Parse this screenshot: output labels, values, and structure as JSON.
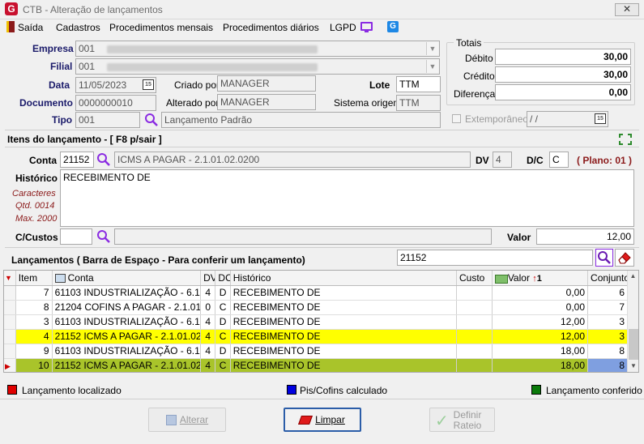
{
  "window": {
    "title": "CTB - Alteração de lançamentos",
    "close_glyph": "✕"
  },
  "menu": [
    "Saída",
    "Cadastros",
    "Procedimentos mensais",
    "Procedimentos diários",
    "LGPD"
  ],
  "form": {
    "empresa_label": "Empresa",
    "empresa_code": "001",
    "filial_label": "Filial",
    "filial_code": "001",
    "data_label": "Data",
    "data_value": "11/05/2023",
    "criado_label": "Criado por",
    "criado_value": "MANAGER",
    "lote_label": "Lote",
    "lote_value": "TTM",
    "documento_label": "Documento",
    "documento_value": "0000000010",
    "alterado_label": "Alterado por",
    "alterado_value": "MANAGER",
    "sistema_label": "Sistema origem",
    "sistema_value": "TTM",
    "tipo_label": "Tipo",
    "tipo_code": "001",
    "tipo_desc": "Lançamento Padrão",
    "extemporaneo_label": "Extemporâneo",
    "extemporaneo_date": " / /",
    "cal_glyph": "15"
  },
  "totais": {
    "title": "Totais",
    "debito_label": "Débito",
    "debito_value": "30,00",
    "credito_label": "Crédito",
    "credito_value": "30,00",
    "diferenca_label": "Diferença",
    "diferenca_value": "0,00"
  },
  "itens": {
    "header": "Itens do lançamento - [ F8 p/sair ]",
    "conta_label": "Conta",
    "conta_code": "21152",
    "conta_desc": "ICMS A PAGAR - 2.1.01.02.0200",
    "dv_label": "DV",
    "dv_value": "4",
    "dc_label": "D/C",
    "dc_value": "C",
    "plano": "( Plano: 01 )",
    "historico_label": "Histórico",
    "historico_value": "RECEBIMENTO DE",
    "caracteres_label": "Caracteres",
    "qtd_label": "Qtd. 0014",
    "max_label": "Max. 2000",
    "ccustos_label": "C/Custos",
    "valor_label": "Valor",
    "valor_value": "12,00"
  },
  "lancamentos": {
    "header": "Lançamentos ( Barra de Espaço - Para conferir um lançamento)",
    "search_value": "21152",
    "columns": [
      "Item",
      "Conta",
      "DV",
      "DC",
      "Histórico",
      "Custo",
      "Valor",
      "Conjunto"
    ],
    "sort_indicator": "1",
    "rows": [
      {
        "item": "7",
        "conta": "61103 INDUSTRIALIZAÇÃO - 6.1....",
        "dv": "4",
        "dc": "D",
        "hist": "RECEBIMENTO DE",
        "custo": "",
        "valor": "0,00",
        "conj": "6",
        "style": "normal"
      },
      {
        "item": "8",
        "conta": "21204 COFINS A PAGAR - 2.1.01....",
        "dv": "0",
        "dc": "C",
        "hist": "RECEBIMENTO DE",
        "custo": "",
        "valor": "0,00",
        "conj": "7",
        "style": "normal"
      },
      {
        "item": "3",
        "conta": "61103 INDUSTRIALIZAÇÃO - 6.1....",
        "dv": "4",
        "dc": "D",
        "hist": "RECEBIMENTO DE",
        "custo": "",
        "valor": "12,00",
        "conj": "3",
        "style": "normal"
      },
      {
        "item": "4",
        "conta": "21152 ICMS A PAGAR - 2.1.01.02....",
        "dv": "4",
        "dc": "C",
        "hist": "RECEBIMENTO DE",
        "custo": "",
        "valor": "12,00",
        "conj": "3",
        "style": "yellow"
      },
      {
        "item": "9",
        "conta": "61103 INDUSTRIALIZAÇÃO - 6.1....",
        "dv": "4",
        "dc": "D",
        "hist": "RECEBIMENTO DE",
        "custo": "",
        "valor": "18,00",
        "conj": "8",
        "style": "normal"
      },
      {
        "item": "10",
        "conta": "21152 ICMS A PAGAR - 2.1.01.02....",
        "dv": "4",
        "dc": "C",
        "hist": "RECEBIMENTO DE",
        "custo": "",
        "valor": "18,00",
        "conj": "8",
        "style": "olive"
      }
    ]
  },
  "legend": {
    "localizado": "Lançamento localizado",
    "localizado_color": "#e00000",
    "piscofins": "Pis/Cofins calculado",
    "piscofins_color": "#0000e0",
    "conferido": "Lançamento conferido",
    "conferido_color": "#0a7a0a"
  },
  "buttons": {
    "alterar": "Alterar",
    "limpar": "Limpar",
    "definir_line1": "Definir",
    "definir_line2": "Rateio"
  }
}
